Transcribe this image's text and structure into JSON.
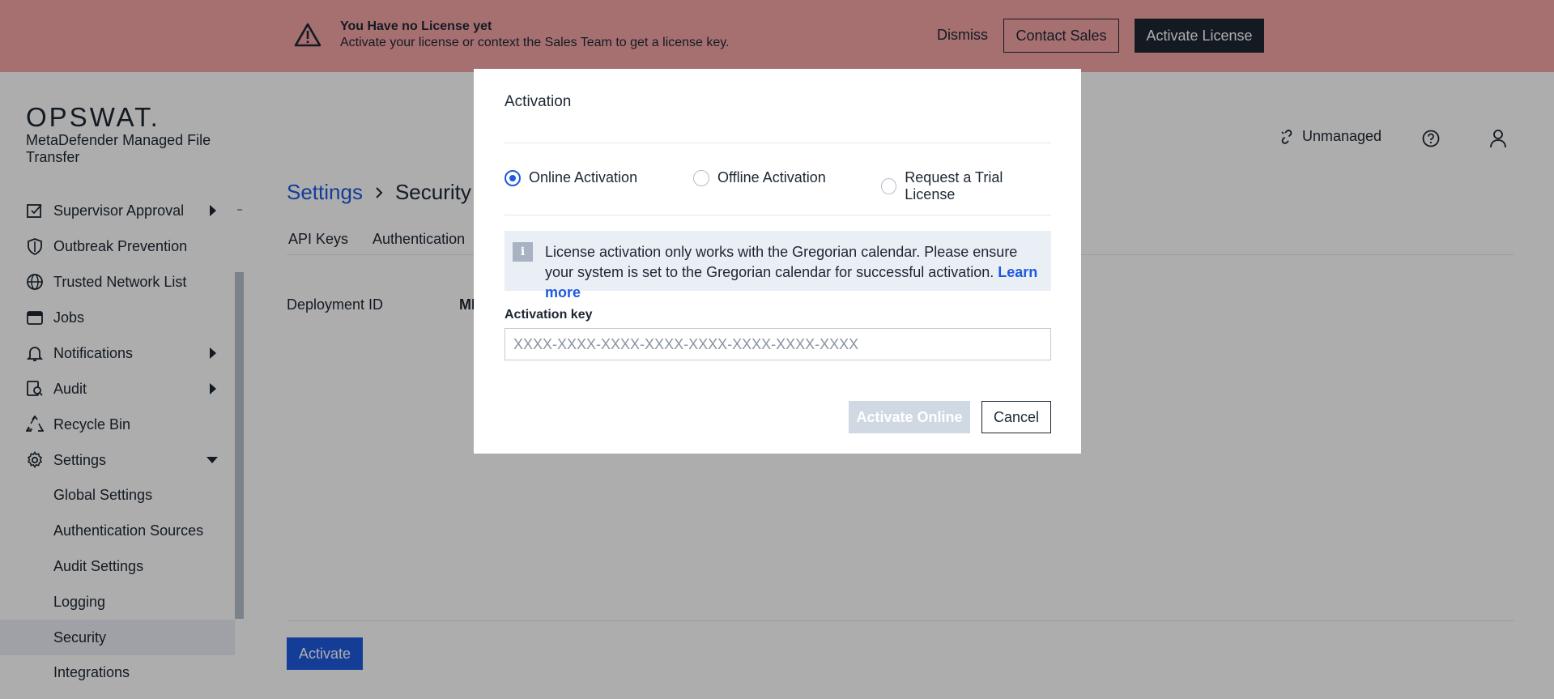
{
  "banner": {
    "title": "You Have no License yet",
    "message": "Activate your license or context the Sales Team to get a license key.",
    "dismiss_label": "Dismiss",
    "contact_sales_label": "Contact Sales",
    "activate_license_label": "Activate License",
    "icon": "warning-icon"
  },
  "brand": {
    "logo": "OPSWAT.",
    "app_name": "MetaDefender Managed File Transfer"
  },
  "sidebar": {
    "items": [
      {
        "label": "Supervisor Approval",
        "icon": "approval-icon",
        "expandable": true
      },
      {
        "label": "Outbreak Prevention",
        "icon": "shield-icon"
      },
      {
        "label": "Trusted Network List",
        "icon": "globe-icon"
      },
      {
        "label": "Jobs",
        "icon": "jobs-icon"
      },
      {
        "label": "Notifications",
        "icon": "bell-icon",
        "expandable": true
      },
      {
        "label": "Audit",
        "icon": "audit-icon",
        "expandable": true
      },
      {
        "label": "Recycle Bin",
        "icon": "recycle-icon"
      },
      {
        "label": "Settings",
        "icon": "gear-icon",
        "expanded": true
      }
    ],
    "settings_children": [
      {
        "label": "Global Settings"
      },
      {
        "label": "Authentication Sources"
      },
      {
        "label": "Audit Settings"
      },
      {
        "label": "Logging"
      },
      {
        "label": "Security",
        "selected": true
      },
      {
        "label": "Integrations"
      }
    ]
  },
  "header": {
    "unmanaged_label": "Unmanaged",
    "help_icon": "help-icon",
    "user_icon": "user-icon"
  },
  "page": {
    "breadcrumb_root": "Settings",
    "breadcrumb_current": "Security",
    "tabs": [
      "API Keys",
      "Authentication"
    ],
    "deployment_id_label": "Deployment ID",
    "deployment_id_value": "MI",
    "activate_label": "Activate"
  },
  "modal": {
    "title": "Activation",
    "options": [
      {
        "label": "Online Activation",
        "checked": true
      },
      {
        "label": "Offline Activation",
        "checked": false
      },
      {
        "label": "Request a Trial License",
        "checked": false
      }
    ],
    "info_text": "License activation only works with the Gregorian calendar. Please ensure your system is set to the Gregorian calendar for successful activation.",
    "info_link": "Learn more",
    "key_label": "Activation key",
    "key_placeholder": "XXXX-XXXX-XXXX-XXXX-XXXX-XXXX-XXXX-XXXX",
    "key_value": "",
    "activate_online_label": "Activate Online",
    "cancel_label": "Cancel"
  },
  "colors": {
    "banner_bg": "#f5a5a7",
    "primary": "#1e5ae0",
    "dark": "#1d2733",
    "disabled_button": "#d0d8e4"
  }
}
